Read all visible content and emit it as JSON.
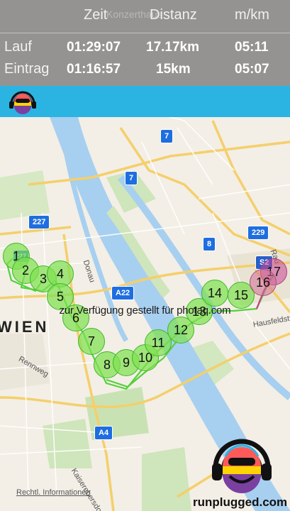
{
  "header": {
    "columns": [
      "Zeit",
      "Distanz",
      "m/km"
    ],
    "rows": [
      {
        "label": "Lauf",
        "time": "01:29:07",
        "distance": "17.17km",
        "pace": "05:11"
      },
      {
        "label": "Eintrag",
        "time": "01:16:57",
        "distance": "15km",
        "pace": "05:07"
      }
    ],
    "behind_text": "Konzerthaus"
  },
  "brand": {
    "color": "#2bb4e2",
    "site": "runplugged.com"
  },
  "map": {
    "city": "WIEN",
    "watermark": "zur Verfügung gestellt für photaq.com",
    "legal_link": "Rechtl. Informationen",
    "labels": [
      "Donau",
      "Rennweg",
      "Hausfeldstraße",
      "Kaiserebersdorfer",
      "Rau"
    ],
    "road_shields": [
      "7",
      "7",
      "227",
      "8",
      "229",
      "S2",
      "A22",
      "A4",
      "227"
    ],
    "markers": [
      "1",
      "2",
      "3",
      "4",
      "5",
      "6",
      "7",
      "8",
      "9",
      "10",
      "11",
      "12",
      "13",
      "14",
      "15",
      "16",
      "17"
    ],
    "route_color": "#55d13a",
    "start_color": "#2f9e2a",
    "end_color": "#c0438a"
  }
}
